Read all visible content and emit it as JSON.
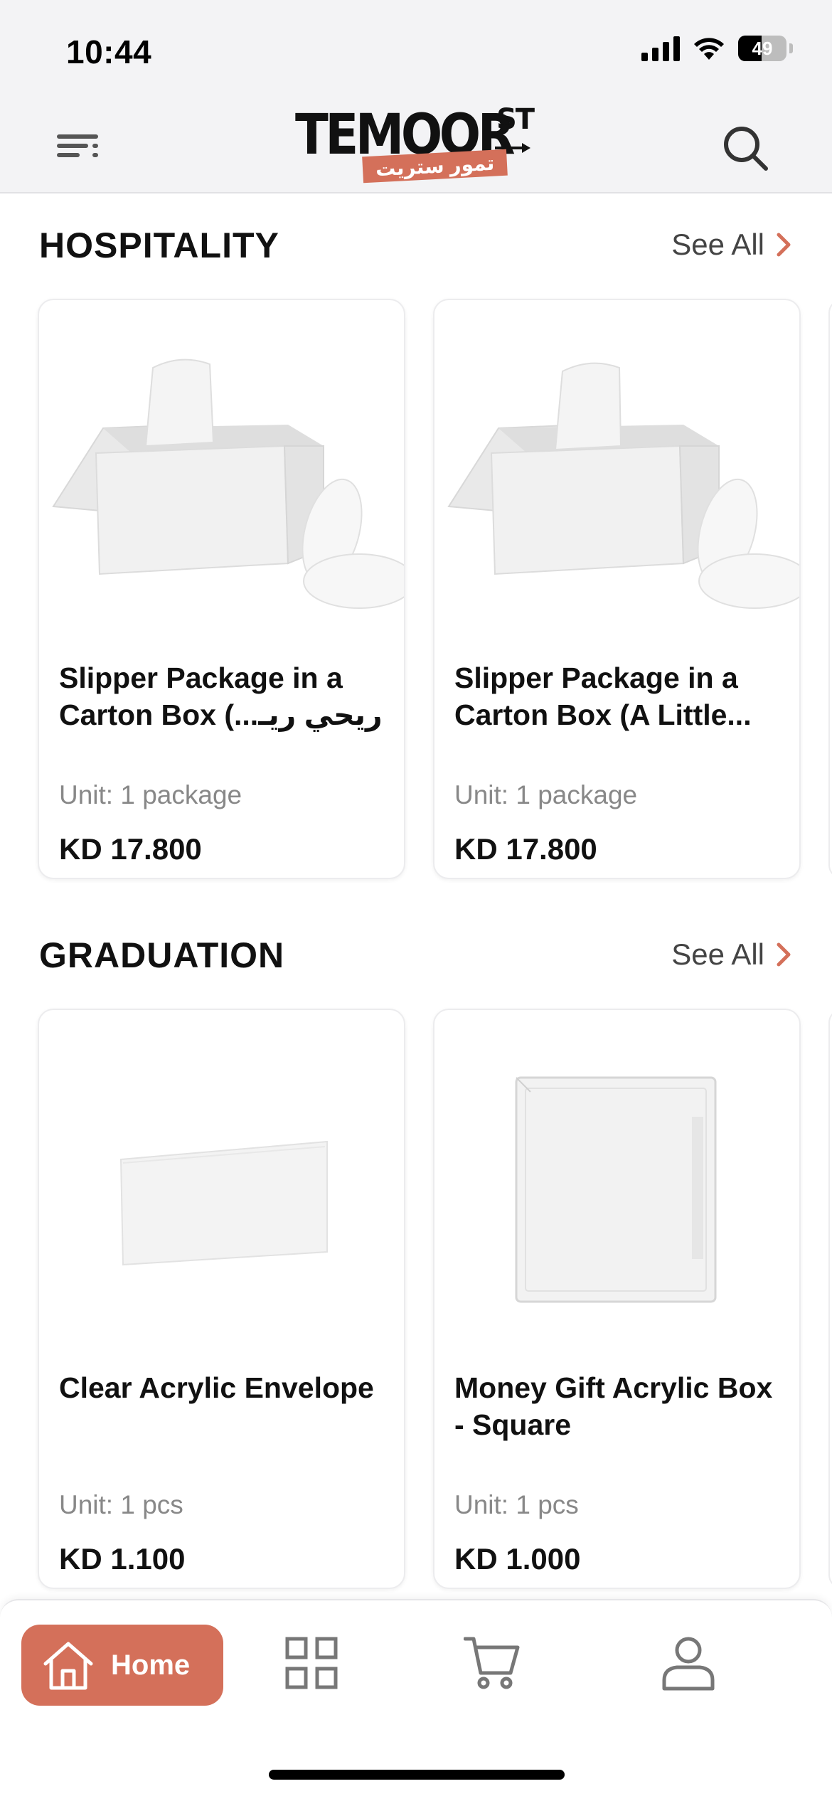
{
  "status_bar": {
    "time": "10:44",
    "battery": "49"
  },
  "header": {
    "logo_text": "TEMOOR",
    "logo_suffix": "ST",
    "logo_arabic": "تمور ستريت",
    "menu_icon": "menu-icon",
    "search_icon": "search-icon"
  },
  "colors": {
    "accent": "#d4705a",
    "text": "#111111",
    "muted": "#888888",
    "header_bg": "#f3f3f5"
  },
  "sections": [
    {
      "title": "HOSPITALITY",
      "see_all": "See All",
      "products": [
        {
          "name": "Slipper Package in a Carton Box (...ريحي ريـ",
          "unit": "Unit: 1 package",
          "price": "KD 17.800"
        },
        {
          "name": "Slipper Package in a Carton Box (A Little...",
          "unit": "Unit: 1 package",
          "price": "KD 17.800"
        }
      ]
    },
    {
      "title": "GRADUATION",
      "see_all": "See All",
      "products": [
        {
          "name": "Clear Acrylic Envelope",
          "unit": "Unit: 1 pcs",
          "price": "KD 1.100"
        },
        {
          "name": "Money Gift Acrylic Box - Square",
          "unit": "Unit: 1 pcs",
          "price": "KD 1.000"
        }
      ]
    }
  ],
  "tabbar": {
    "home_label": "Home",
    "icons": [
      "home-icon",
      "categories-icon",
      "cart-icon",
      "profile-icon"
    ]
  }
}
